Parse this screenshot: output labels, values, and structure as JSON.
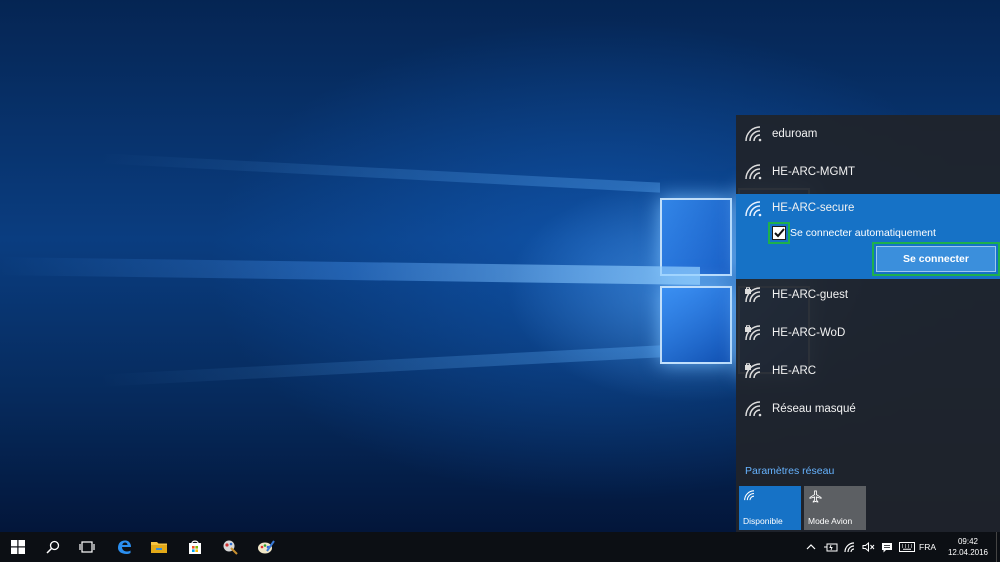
{
  "networks": [
    {
      "name": "eduroam",
      "secured": false
    },
    {
      "name": "HE-ARC-MGMT",
      "secured": false
    },
    {
      "name": "HE-ARC-secure",
      "secured": false,
      "selected": true
    },
    {
      "name": "HE-ARC-guest",
      "secured": true
    },
    {
      "name": "HE-ARC-WoD",
      "secured": true
    },
    {
      "name": "HE-ARC",
      "secured": true
    },
    {
      "name": "Réseau masqué",
      "secured": false
    }
  ],
  "selected_network": {
    "auto_connect_label": "Se connecter automatiquement",
    "auto_connect_checked": true,
    "connect_label": "Se connecter"
  },
  "settings_link": "Paramètres réseau",
  "quick_actions": [
    {
      "label": "Disponible",
      "icon": "wifi-icon",
      "active": true
    },
    {
      "label": "Mode Avion",
      "icon": "airplane-icon",
      "active": false
    }
  ],
  "taskbar": {
    "items": [
      "start-icon",
      "search-icon",
      "task-view-icon",
      "edge-icon",
      "file-explorer-icon",
      "store-icon",
      "app-icon",
      "paint-icon"
    ],
    "language": "FRA",
    "time": "09:42",
    "date": "12.04.2016"
  },
  "colors": {
    "accent": "#1672c6",
    "highlight_border": "#1eb04c",
    "link": "#66b3ff"
  }
}
